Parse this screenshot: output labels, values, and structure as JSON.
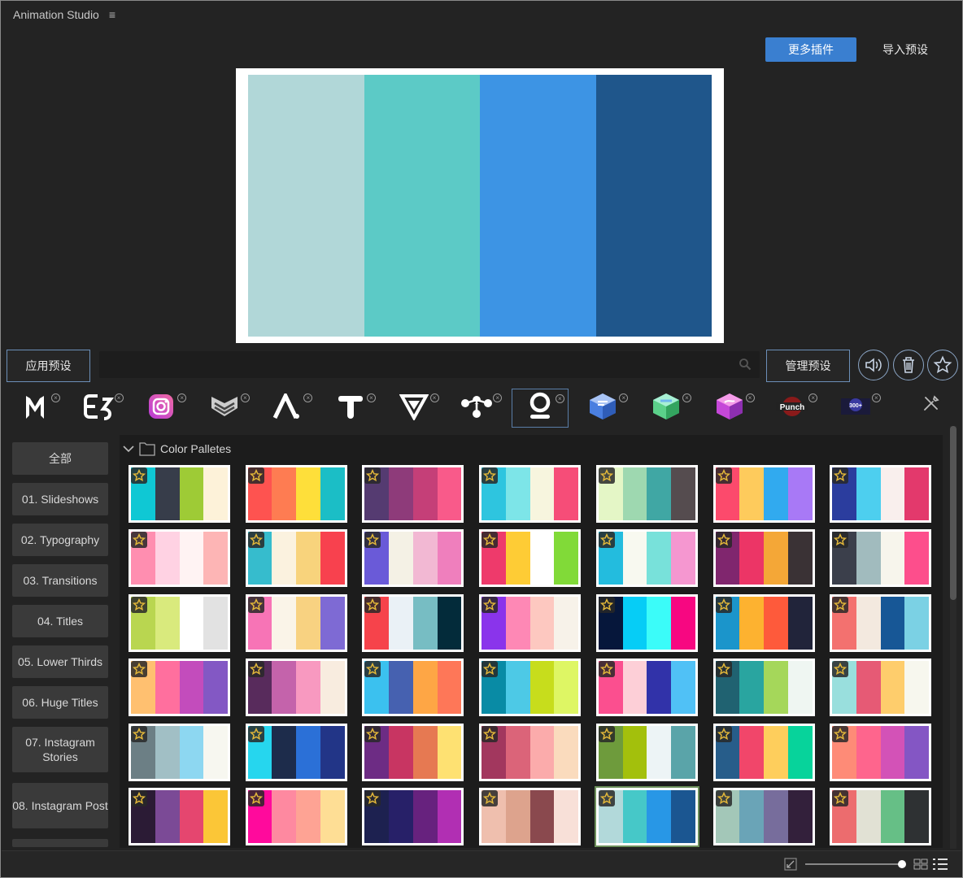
{
  "app": {
    "title": "Animation Studio",
    "menu_glyph": "≡"
  },
  "header": {
    "more_plugins": "更多插件",
    "import_presets": "导入预设"
  },
  "preview": {
    "colors": [
      "#b1d7d8",
      "#5ccac6",
      "#3d94e4",
      "#1f568b"
    ]
  },
  "toolbar": {
    "apply_preset": "应用预设",
    "search_value": "",
    "manage_presets": "管理预设"
  },
  "plugins": [
    {
      "name": "plugin-m",
      "icon": "m-logo-icon"
    },
    {
      "name": "plugin-e",
      "icon": "e-logo-icon"
    },
    {
      "name": "plugin-instagram",
      "icon": "instagram-icon"
    },
    {
      "name": "plugin-chevron",
      "icon": "chevron-badge-icon"
    },
    {
      "name": "plugin-a",
      "icon": "a-logo-icon"
    },
    {
      "name": "plugin-t",
      "icon": "t-logo-icon"
    },
    {
      "name": "plugin-v",
      "icon": "v-logo-icon"
    },
    {
      "name": "plugin-nodes",
      "icon": "nodes-icon"
    },
    {
      "name": "plugin-o",
      "icon": "o-logo-icon",
      "active": true
    },
    {
      "name": "plugin-cube-blue",
      "icon": "cube-blue-icon"
    },
    {
      "name": "plugin-cube-green",
      "icon": "cube-green-icon"
    },
    {
      "name": "plugin-cube-pink",
      "icon": "cube-pink-icon"
    },
    {
      "name": "plugin-punch",
      "icon": "punch-logo-icon",
      "label": "Punch"
    },
    {
      "name": "plugin-transitions",
      "icon": "transitions-logo-icon",
      "label": "300+"
    }
  ],
  "categories": [
    {
      "label": "全部"
    },
    {
      "label": "01. Slideshows"
    },
    {
      "label": "02. Typography"
    },
    {
      "label": "03. Transitions"
    },
    {
      "label": "04. Titles"
    },
    {
      "label": "05. Lower Thirds"
    },
    {
      "label": "06. Huge Titles"
    },
    {
      "label": "07. Instagram Stories",
      "tall": true
    },
    {
      "label": "08. Instagram Post",
      "tall": true
    }
  ],
  "folder": {
    "name": "Color Palletes"
  },
  "palettes": [
    [
      "#0fc8d4",
      "#373d4a",
      "#9ecb36",
      "#fdf2d9"
    ],
    [
      "#fe5350",
      "#fe7c52",
      "#fedf3a",
      "#1bbec6"
    ],
    [
      "#553b71",
      "#8e3b7a",
      "#c53f78",
      "#f95a8a"
    ],
    [
      "#2ec5df",
      "#7de5e8",
      "#f7f5de",
      "#f64d78"
    ],
    [
      "#e4f6c6",
      "#9ed8b0",
      "#40a7a4",
      "#554c4f"
    ],
    [
      "#fc4a6c",
      "#fecb5c",
      "#31aaef",
      "#a879f6"
    ],
    [
      "#2b3d9e",
      "#4dcfef",
      "#f9efed",
      "#e3396c"
    ],
    [
      "#ff8eb0",
      "#ffd2e3",
      "#fff3f3",
      "#fdb5b5"
    ],
    [
      "#36bccd",
      "#fbf2df",
      "#f8d37c",
      "#f8414e"
    ],
    [
      "#6a5ad8",
      "#f4f1e5",
      "#f2b8d3",
      "#ef7fbd"
    ],
    [
      "#ee3a6b",
      "#fecc35",
      "#ffffff",
      "#81da38"
    ],
    [
      "#23bcde",
      "#f8f9f0",
      "#78e1da",
      "#f597d0"
    ],
    [
      "#80266e",
      "#ec3566",
      "#f4a737",
      "#3a3235"
    ],
    [
      "#3b3f4b",
      "#a1bbbe",
      "#f7f5ec",
      "#fd4e8c"
    ],
    [
      "#b9d650",
      "#d9ea7d",
      "#ffffff",
      "#e2e2e2"
    ],
    [
      "#f774b6",
      "#faf4e8",
      "#f8d281",
      "#7e6ad4"
    ],
    [
      "#f6434b",
      "#eaf1f6",
      "#77bdc3",
      "#032b3a"
    ],
    [
      "#8a34eb",
      "#fe88b5",
      "#fdc8c0",
      "#f7f2e9"
    ],
    [
      "#06173b",
      "#06cdf6",
      "#3bfcf9",
      "#f70781"
    ],
    [
      "#1b95cb",
      "#fdb230",
      "#fe5a3b",
      "#21243a"
    ],
    [
      "#f3716f",
      "#f3e9df",
      "#175796",
      "#7bd1e4"
    ],
    [
      "#ffc070",
      "#ff6f9e",
      "#c34cbc",
      "#8358c4"
    ],
    [
      "#582b5c",
      "#c463ab",
      "#f899c0",
      "#f8ecdf"
    ],
    [
      "#3bc1ef",
      "#4661b0",
      "#fea645",
      "#fe7758"
    ],
    [
      "#098ba5",
      "#4dc9e6",
      "#c7dd1c",
      "#def664"
    ],
    [
      "#fb4f8f",
      "#fdcfd7",
      "#3132a9",
      "#50c1f6"
    ],
    [
      "#206271",
      "#29a5a0",
      "#a5d75a",
      "#eff6f2"
    ],
    [
      "#99dfdd",
      "#e65a75",
      "#fecd6c",
      "#f7f7ee"
    ],
    [
      "#6c7f85",
      "#a1bfc5",
      "#8dd7f1",
      "#f7f7f0"
    ],
    [
      "#26d6ee",
      "#1d2c4b",
      "#2b70d7",
      "#223587"
    ],
    [
      "#6d2c84",
      "#c83562",
      "#e67952",
      "#fee172"
    ],
    [
      "#a2375e",
      "#db6479",
      "#fbabab",
      "#fadbbd"
    ],
    [
      "#6e9b3c",
      "#a3c00c",
      "#edf4f6",
      "#5aa4a9"
    ],
    [
      "#275d8a",
      "#f1466a",
      "#fece5c",
      "#07d39b"
    ],
    [
      "#fe8b77",
      "#fe658d",
      "#d352b7",
      "#8456c4"
    ],
    [
      "#2b1b35",
      "#7b4a96",
      "#e5466f",
      "#fbc637"
    ],
    [
      "#ff0a9c",
      "#fe89a0",
      "#fea394",
      "#fede95"
    ],
    [
      "#1d2150",
      "#272068",
      "#67227e",
      "#b12fb3"
    ],
    [
      "#efbfae",
      "#dda38d",
      "#8a494e",
      "#f8e0d8"
    ],
    [
      "#b2d9da",
      "#46c8c8",
      "#2897e6",
      "#1b5691"
    ],
    [
      "#a3c7b8",
      "#6aa4b7",
      "#776d9c",
      "#33203b"
    ],
    [
      "#ec6c6e",
      "#e1e1d4",
      "#66bf86",
      "#2e3133"
    ]
  ],
  "selected_index": 39
}
